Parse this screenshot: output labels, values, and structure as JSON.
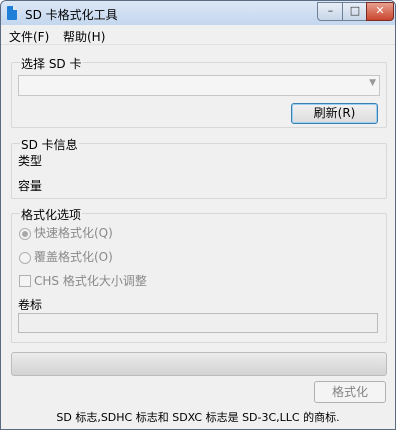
{
  "window": {
    "title": "SD 卡格式化工具",
    "close_glyph": "✕",
    "min_glyph": "–",
    "max_glyph": "□"
  },
  "menu": {
    "file": "文件(F)",
    "help": "帮助(H)"
  },
  "select_card": {
    "label": "选择 SD 卡",
    "value": "",
    "refresh_label": "刷新(R)"
  },
  "card_info": {
    "label": "SD 卡信息",
    "type_label": "类型",
    "capacity_label": "容量"
  },
  "format_options": {
    "label": "格式化选项",
    "quick": {
      "label": "快速格式化(Q)",
      "selected": true
    },
    "overwrite": {
      "label": "覆盖格式化(O)",
      "selected": false
    },
    "chs": {
      "label": "CHS 格式化大小调整",
      "checked": false
    },
    "volume_label": "卷标",
    "volume_value": ""
  },
  "progress": {
    "value": 0
  },
  "format_button": "格式化",
  "footer": "SD 标志,SDHC 标志和 SDXC 标志是 SD-3C,LLC 的商标."
}
